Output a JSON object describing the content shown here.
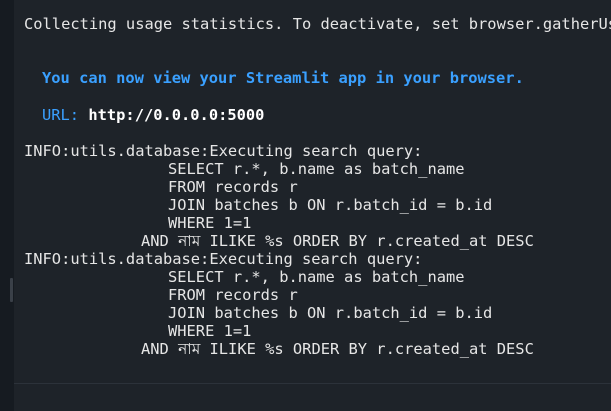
{
  "terminal": {
    "usage_line": "Collecting usage statistics. To deactivate, set browser.gatherUsageStats to False.",
    "app_ready_line": "You can now view your Streamlit app in your browser.",
    "url_label": "URL:",
    "url_value": "http://0.0.0.0:5000",
    "log_blocks": [
      {
        "header": "INFO:utils.database:Executing search query:",
        "line1": "SELECT r.*, b.name as batch_name",
        "line2": "FROM records r",
        "line3": "JOIN batches b ON r.batch_id = b.id",
        "line4": "WHERE 1=1",
        "line5": "AND নাম ILIKE %s ORDER BY r.created_at DESC"
      },
      {
        "header": "INFO:utils.database:Executing search query:",
        "line1": "SELECT r.*, b.name as batch_name",
        "line2": "FROM records r",
        "line3": "JOIN batches b ON r.batch_id = b.id",
        "line4": "WHERE 1=1",
        "line5": "AND নাম ILIKE %s ORDER BY r.created_at DESC"
      }
    ]
  }
}
